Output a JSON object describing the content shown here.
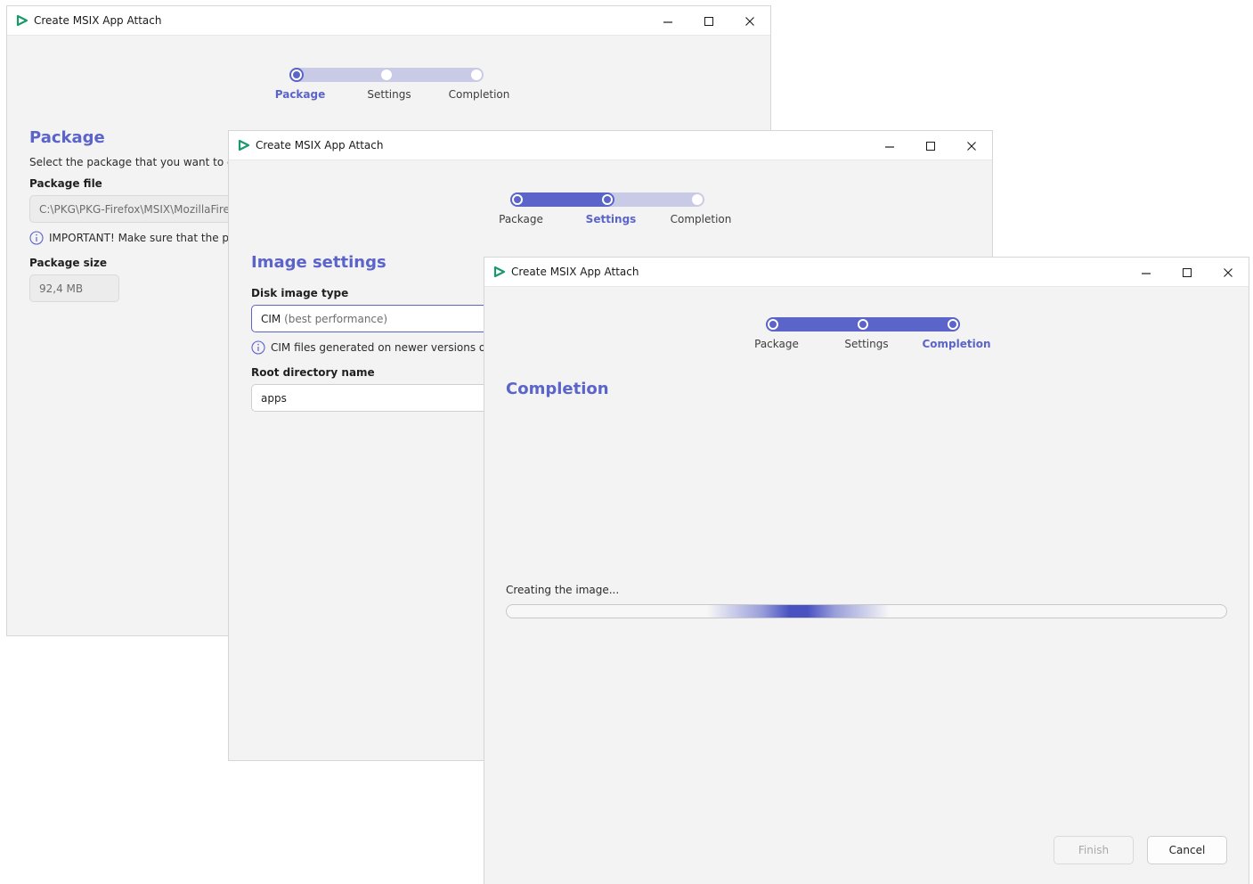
{
  "colors": {
    "accent": "#5b64c8",
    "accent_light": "#c9cae6",
    "app_icon": "#1a9a6a"
  },
  "windows": {
    "package": {
      "title": "Create MSIX App Attach",
      "steps": [
        "Package",
        "Settings",
        "Completion"
      ],
      "active_step": 0,
      "heading": "Package",
      "description": "Select the package that you want to conve",
      "package_file_label": "Package file",
      "package_file_value": "C:\\PKG\\PKG-Firefox\\MSIX\\MozillaFirefox",
      "important_note": "IMPORTANT! Make sure that the pack",
      "package_size_label": "Package size",
      "package_size_value": "92,4 MB"
    },
    "settings": {
      "title": "Create MSIX App Attach",
      "steps": [
        "Package",
        "Settings",
        "Completion"
      ],
      "active_step": 1,
      "heading": "Image settings",
      "disk_image_type_label": "Disk image type",
      "disk_image_type_value": "CIM",
      "disk_image_type_hint": "(best performance)",
      "cim_note": "CIM files generated on newer versions of Wi",
      "root_dir_label": "Root directory name",
      "root_dir_value": "apps"
    },
    "completion": {
      "title": "Create MSIX App Attach",
      "steps": [
        "Package",
        "Settings",
        "Completion"
      ],
      "active_step": 2,
      "heading": "Completion",
      "progress_text": "Creating the image...",
      "finish_label": "Finish",
      "cancel_label": "Cancel"
    }
  }
}
